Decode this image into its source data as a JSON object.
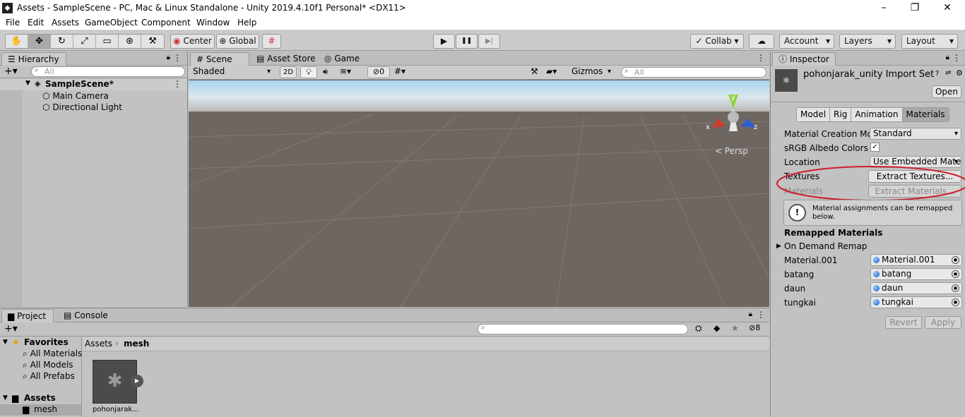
{
  "window": {
    "title": "Assets - SampleScene - PC, Mac & Linux Standalone - Unity 2019.4.10f1 Personal* <DX11>",
    "app_icon": "unity-icon",
    "controls": [
      "–",
      "❐",
      "✕"
    ]
  },
  "menu": [
    "File",
    "Edit",
    "Assets",
    "GameObject",
    "Component",
    "Window",
    "Help"
  ],
  "toolbar": {
    "tools": [
      "✋",
      "✥",
      "↻",
      "⤢",
      "▭",
      "⊛",
      "⚒"
    ],
    "pivot": "Center",
    "space": "Global",
    "play": "▶",
    "pause": "❚❚",
    "step": "▶|",
    "collab": "Collab",
    "account": "Account",
    "layers": "Layers",
    "layout": "Layout"
  },
  "hierarchy": {
    "tab": "Hierarchy",
    "search_placeholder": "All",
    "scene": "SampleScene*",
    "items": [
      "Main Camera",
      "Directional Light"
    ]
  },
  "scene_view": {
    "tabs": [
      "Scene",
      "Asset Store",
      "Game"
    ],
    "shading": "Shaded",
    "mode2d": "2D",
    "hidden_count": "0",
    "gizmos": "Gizmos",
    "search_placeholder": "All",
    "axes": {
      "x": "x",
      "y": "y",
      "z": "z"
    },
    "persp": "< Persp"
  },
  "inspector": {
    "tab": "Inspector",
    "asset_title": "pohonjarak_unity Import Set",
    "open_label": "Open",
    "tabs": [
      "Model",
      "Rig",
      "Animation",
      "Materials"
    ],
    "active_tab": "Materials",
    "material_creation_label": "Material Creation Mo",
    "material_creation_value": "Standard",
    "srgb_label": "sRGB Albedo Colors",
    "srgb_checked": "✓",
    "location_label": "Location",
    "location_value": "Use Embedded Mate",
    "textures_label": "Textures",
    "extract_textures": "Extract Textures...",
    "materials_label": "Materials",
    "extract_materials": "Extract Materials...",
    "info_text": "Material assignments can be remapped below.",
    "remapped_header": "Remapped Materials",
    "on_demand": "On Demand Remap",
    "remaps": [
      {
        "name": "Material.001",
        "value": "Material.001"
      },
      {
        "name": "batang",
        "value": "batang"
      },
      {
        "name": "daun",
        "value": "daun"
      },
      {
        "name": "tungkai",
        "value": "tungkai"
      }
    ],
    "revert": "Revert",
    "apply": "Apply",
    "highlight_color": "#cc1f2d"
  },
  "project": {
    "tabs": [
      "Project",
      "Console"
    ],
    "hidden_count": "8",
    "favorites_label": "Favorites",
    "favorites": [
      "All Materials",
      "All Models",
      "All Prefabs"
    ],
    "assets_label": "Assets",
    "folder": "mesh",
    "breadcrumb": [
      "Assets",
      "mesh"
    ],
    "asset_name": "pohonjarak..."
  }
}
